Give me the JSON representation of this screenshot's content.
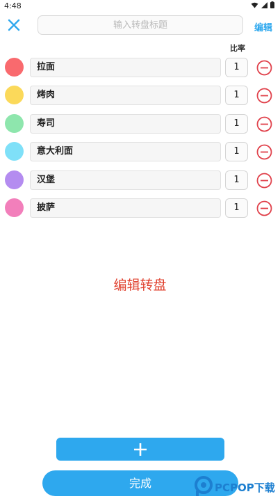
{
  "status_bar": {
    "time": "4:48"
  },
  "toolbar": {
    "title_placeholder": "输入转盘标题",
    "edit_label": "编辑"
  },
  "list": {
    "ratio_header": "比率",
    "items": [
      {
        "name": "拉面",
        "ratio": "1",
        "color": "#f96a6e"
      },
      {
        "name": "烤肉",
        "ratio": "1",
        "color": "#fbd95a"
      },
      {
        "name": "寿司",
        "ratio": "1",
        "color": "#8ee6ad"
      },
      {
        "name": "意大利面",
        "ratio": "1",
        "color": "#7fe0f8"
      },
      {
        "name": "汉堡",
        "ratio": "1",
        "color": "#b48cf0"
      },
      {
        "name": "披萨",
        "ratio": "1",
        "color": "#f27fbb"
      }
    ]
  },
  "center_label": "编辑转盘",
  "footer": {
    "done_label": "完成"
  },
  "watermark": {
    "text": "PCPOP下载"
  },
  "colors": {
    "accent": "#2ea8ee",
    "remove": "#e0404a",
    "label_red": "#e0402e"
  }
}
